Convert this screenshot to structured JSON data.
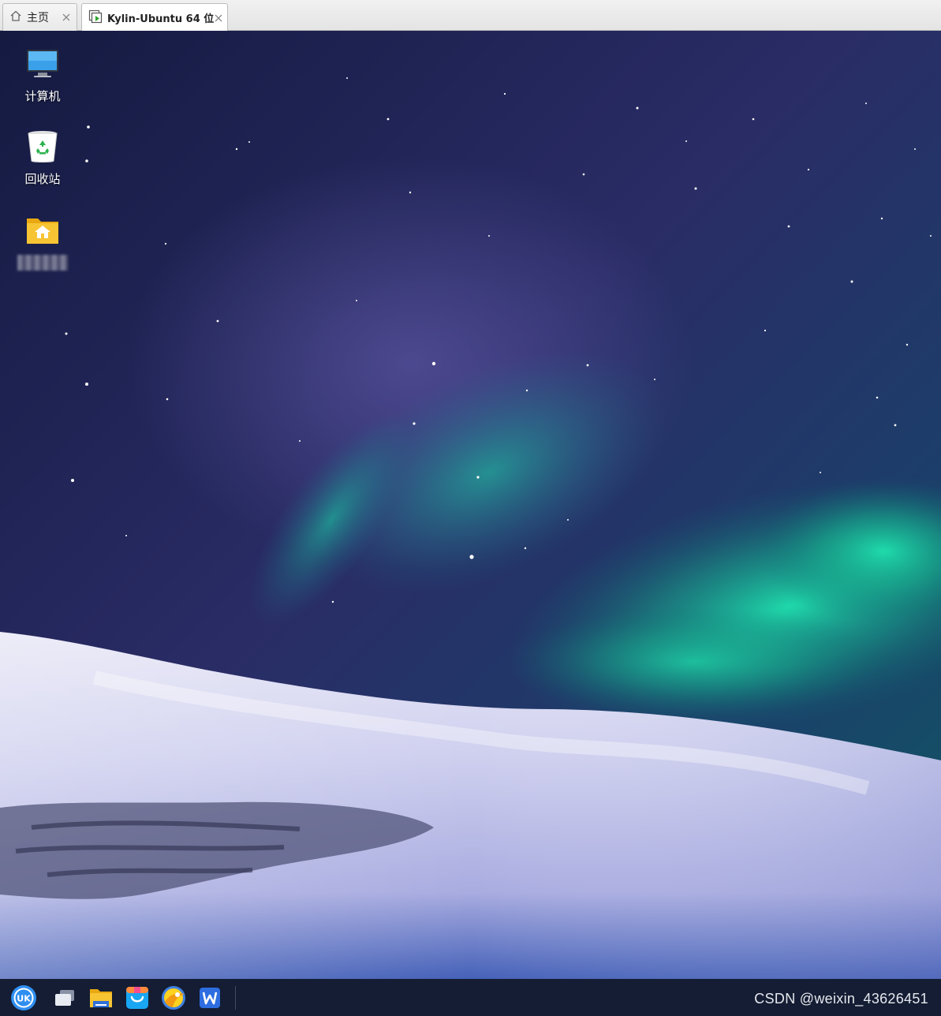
{
  "tabs": [
    {
      "label": "主页",
      "icon": "home-icon"
    },
    {
      "label": "Kylin-Ubuntu 64 位",
      "icon": "vm-running-icon",
      "active": true
    }
  ],
  "desktop_icons": [
    {
      "label": "计算机",
      "icon": "computer-icon"
    },
    {
      "label": "回收站",
      "icon": "recycle-bin-icon"
    },
    {
      "label": "",
      "icon": "home-folder-icon"
    }
  ],
  "taskbar": {
    "apps": [
      "start-menu-icon",
      "multitask-view-icon",
      "file-manager-icon",
      "software-store-icon",
      "browser-icon",
      "wps-writer-icon"
    ]
  },
  "watermark": "CSDN @weixin_43626451",
  "colors": {
    "taskbar": "#141d33",
    "sky_top": "#1a2248",
    "aurora": "#1fd6a4",
    "snow": "#d9daf0"
  }
}
